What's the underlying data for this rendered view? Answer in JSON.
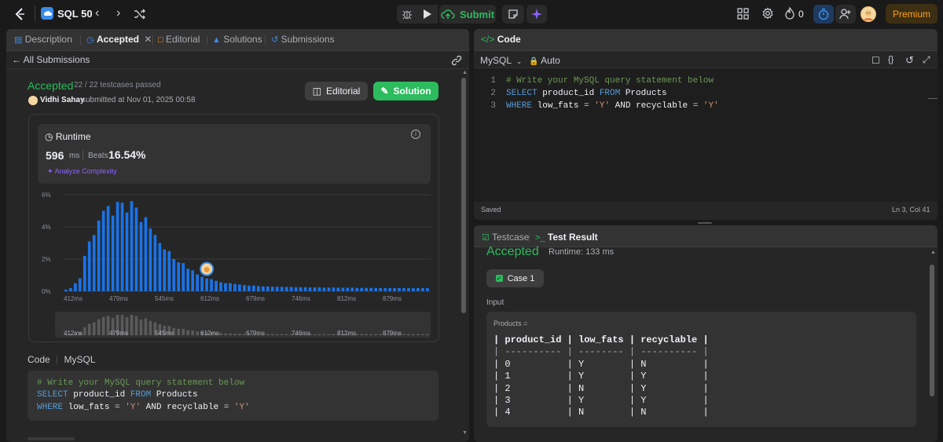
{
  "header": {
    "list_name": "SQL 50",
    "submit_label": "Submit",
    "streak_count": "0",
    "premium_label": "Premium"
  },
  "left_tabs": {
    "description": "Description",
    "accepted": "Accepted",
    "editorial": "Editorial",
    "solutions": "Solutions",
    "submissions": "Submissions"
  },
  "submission": {
    "back_label": "All Submissions",
    "status": "Accepted",
    "testcases": "22 / 22 testcases passed",
    "user": "Vidhi Sahay",
    "submitted_text": "submitted at Nov 01, 2025 00:58",
    "editorial_btn": "Editorial",
    "solution_btn": "Solution"
  },
  "runtime": {
    "label": "Runtime",
    "value": "596",
    "unit": "ms",
    "beats_label": "Beats",
    "beats_value": "16.54%",
    "analyze_label": "Analyze Complexity"
  },
  "chart_data": {
    "type": "bar",
    "ylabels": [
      "6%",
      "4%",
      "2%",
      "0%"
    ],
    "ylim": [
      0,
      6
    ],
    "xlabels": [
      "412ms",
      "479ms",
      "545ms",
      "612ms",
      "679ms",
      "746ms",
      "812ms",
      "879ms"
    ],
    "values": [
      0.1,
      0.2,
      0.5,
      0.8,
      2.2,
      3.1,
      3.5,
      4.4,
      5.0,
      5.3,
      4.7,
      5.55,
      5.5,
      4.9,
      5.6,
      5.2,
      4.3,
      4.6,
      3.9,
      3.5,
      3.0,
      2.6,
      2.5,
      2.0,
      1.8,
      1.75,
      1.4,
      1.3,
      1.05,
      0.9,
      0.8,
      0.75,
      0.65,
      0.55,
      0.5,
      0.5,
      0.45,
      0.42,
      0.38,
      0.35,
      0.35,
      0.32,
      0.3,
      0.3,
      0.28,
      0.28,
      0.27,
      0.27,
      0.26,
      0.25,
      0.25,
      0.25,
      0.24,
      0.24,
      0.24,
      0.23,
      0.23,
      0.23,
      0.22,
      0.22,
      0.22,
      0.22,
      0.21,
      0.21,
      0.21,
      0.21,
      0.2,
      0.2,
      0.2,
      0.2,
      0.2,
      0.2,
      0.2,
      0.2,
      0.2,
      0.2,
      0.2,
      0.2
    ],
    "highlight_index": 30,
    "bar_color": "#1a73e8",
    "mini_bar_color": "#5a5a5a"
  },
  "left_code": {
    "label": "Code",
    "lang": "MySQL",
    "lines": [
      [
        {
          "t": "# Write your MySQL query statement below",
          "c": "cm"
        }
      ],
      [
        {
          "t": "SELECT",
          "c": "kw"
        },
        {
          "t": " product_id ",
          "c": "tx"
        },
        {
          "t": "FROM",
          "c": "kw"
        },
        {
          "t": " Products",
          "c": "tx"
        }
      ],
      [
        {
          "t": "WHERE",
          "c": "kw"
        },
        {
          "t": " low_fats ",
          "c": "tx"
        },
        {
          "t": "=",
          "c": "op"
        },
        {
          "t": " ",
          "c": "tx"
        },
        {
          "t": "'Y'",
          "c": "str"
        },
        {
          "t": " AND recyclable ",
          "c": "tx"
        },
        {
          "t": "=",
          "c": "op"
        },
        {
          "t": " ",
          "c": "tx"
        },
        {
          "t": "'Y'",
          "c": "str"
        }
      ]
    ]
  },
  "editor": {
    "title": "Code",
    "lang": "MySQL",
    "auto_label": "Auto",
    "saved_label": "Saved",
    "cursor_pos": "Ln 3, Col 41",
    "line_numbers": [
      "1",
      "2",
      "3"
    ]
  },
  "result": {
    "testcase_tab": "Testcase",
    "result_tab": "Test Result",
    "status": "Accepted",
    "runtime": "Runtime: 133 ms",
    "case_label": "Case 1",
    "input_label": "Input",
    "var_label": "Products =",
    "table_lines": [
      "| product_id | low_fats | recyclable |",
      "| ---------- | -------- | ---------- |",
      "| 0          | Y        | N          |",
      "| 1          | Y        | Y          |",
      "| 2          | N        | Y          |",
      "| 3          | Y        | Y          |",
      "| 4          | N        | N          |"
    ]
  },
  "colors": {
    "accent_green": "#2cbb5d",
    "premium": "#ffa116",
    "ai_purple": "#8a63ff"
  }
}
